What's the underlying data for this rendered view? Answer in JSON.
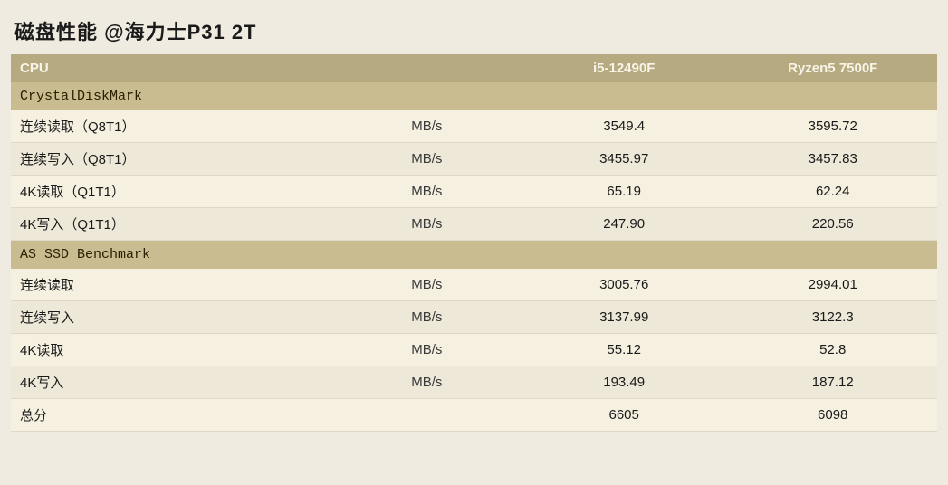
{
  "title": "磁盘性能 @海力士P31  2T",
  "header": {
    "cpu_label": "CPU",
    "cpu1": "i5-12490F",
    "cpu2": "Ryzen5 7500F"
  },
  "sections": [
    {
      "name": "CrystalDiskMark",
      "rows": [
        {
          "label": "连续读取（Q8T1）",
          "unit": "MB/s",
          "cpu1": "3549.4",
          "cpu2": "3595.72"
        },
        {
          "label": "连续写入（Q8T1）",
          "unit": "MB/s",
          "cpu1": "3455.97",
          "cpu2": "3457.83"
        },
        {
          "label": "4K读取（Q1T1）",
          "unit": "MB/s",
          "cpu1": "65.19",
          "cpu2": "62.24"
        },
        {
          "label": "4K写入（Q1T1）",
          "unit": "MB/s",
          "cpu1": "247.90",
          "cpu2": "220.56"
        }
      ]
    },
    {
      "name": "AS SSD Benchmark",
      "rows": [
        {
          "label": "连续读取",
          "unit": "MB/s",
          "cpu1": "3005.76",
          "cpu2": "2994.01"
        },
        {
          "label": "连续写入",
          "unit": "MB/s",
          "cpu1": "3137.99",
          "cpu2": "3122.3"
        },
        {
          "label": "4K读取",
          "unit": "MB/s",
          "cpu1": "55.12",
          "cpu2": "52.8"
        },
        {
          "label": "4K写入",
          "unit": "MB/s",
          "cpu1": "193.49",
          "cpu2": "187.12"
        },
        {
          "label": "总分",
          "unit": "",
          "cpu1": "6605",
          "cpu2": "6098"
        }
      ]
    }
  ]
}
